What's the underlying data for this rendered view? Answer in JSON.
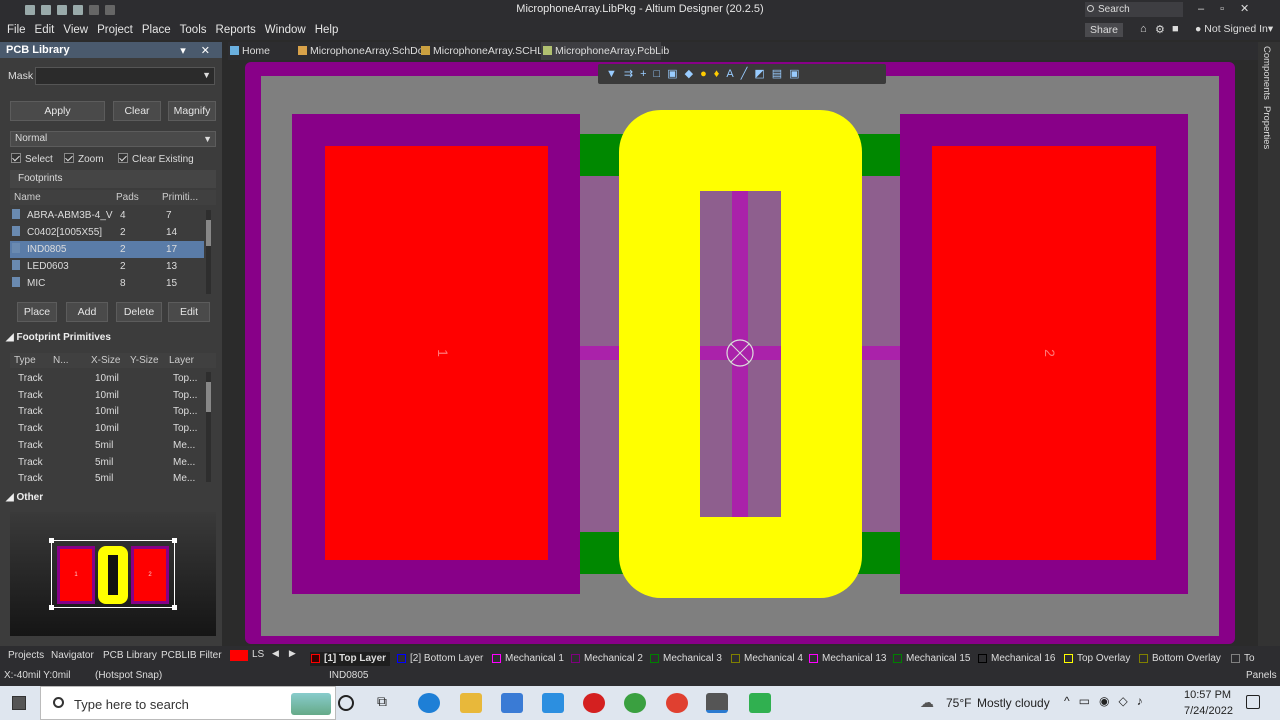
{
  "window": {
    "title": "MicrophoneArray.LibPkg - Altium Designer (20.2.5)",
    "search": "Search",
    "share": "Share",
    "account": "Not Signed In"
  },
  "menu": [
    "File",
    "Edit",
    "View",
    "Project",
    "Place",
    "Tools",
    "Reports",
    "Window",
    "Help"
  ],
  "panel": {
    "title": "PCB Library",
    "mask_label": "Mask",
    "mask_value": "",
    "apply": "Apply",
    "clear": "Clear",
    "magnify": "Magnify",
    "mode": "Normal",
    "select": "Select",
    "zoom": "Zoom",
    "clear_existing": "Clear Existing",
    "footprints_title": "Footprints",
    "fp_headers": [
      "Name",
      "Pads",
      "Primiti..."
    ],
    "footprints": [
      {
        "name": "ABRA-ABM3B-4_V",
        "pads": "4",
        "prims": "7"
      },
      {
        "name": "C0402[1005X55]",
        "pads": "2",
        "prims": "14"
      },
      {
        "name": "IND0805",
        "pads": "2",
        "prims": "17"
      },
      {
        "name": "LED0603",
        "pads": "2",
        "prims": "13"
      },
      {
        "name": "MIC",
        "pads": "8",
        "prims": "15"
      }
    ],
    "place": "Place",
    "add": "Add",
    "delete": "Delete",
    "edit": "Edit",
    "prims_title": "Footprint Primitives",
    "prim_headers": [
      "Type",
      "N...",
      "X-Size",
      "Y-Size",
      "Layer"
    ],
    "primitives": [
      {
        "type": "Track",
        "x": "10mil",
        "layer": "Top..."
      },
      {
        "type": "Track",
        "x": "10mil",
        "layer": "Top..."
      },
      {
        "type": "Track",
        "x": "10mil",
        "layer": "Top..."
      },
      {
        "type": "Track",
        "x": "10mil",
        "layer": "Top..."
      },
      {
        "type": "Track",
        "x": "5mil",
        "layer": "Me..."
      },
      {
        "type": "Track",
        "x": "5mil",
        "layer": "Me..."
      },
      {
        "type": "Track",
        "x": "5mil",
        "layer": "Me..."
      }
    ],
    "other_title": "Other",
    "preview_pad1": "1",
    "preview_pad2": "2"
  },
  "doc_tabs": [
    "Home Page",
    "MicrophoneArray.SchDoc",
    "MicrophoneArray.SCHLIB",
    "MicrophoneArray.PcbLib"
  ],
  "canvas": {
    "pad1": "1",
    "pad2": "2"
  },
  "right_tabs": [
    "Components",
    "Properties"
  ],
  "bottom_panels": [
    "Projects",
    "Navigator",
    "PCB Library",
    "PCBLIB Filter"
  ],
  "ls": "LS",
  "layers": [
    {
      "name": "[1] Top Layer",
      "color": "#ff0000"
    },
    {
      "name": "[2] Bottom Layer",
      "color": "#0000ff"
    },
    {
      "name": "Mechanical 1",
      "color": "#ff00ff"
    },
    {
      "name": "Mechanical 2",
      "color": "#800080"
    },
    {
      "name": "Mechanical 3",
      "color": "#008000"
    },
    {
      "name": "Mechanical 4",
      "color": "#808000"
    },
    {
      "name": "Mechanical 13",
      "color": "#ff00ff"
    },
    {
      "name": "Mechanical 15",
      "color": "#008000"
    },
    {
      "name": "Mechanical 16",
      "color": "#000000"
    },
    {
      "name": "Top Overlay",
      "color": "#ffff00"
    },
    {
      "name": "Bottom Overlay",
      "color": "#808000"
    },
    {
      "name": "To",
      "color": "#808080"
    }
  ],
  "statusline": {
    "coords": "X:-40mil Y:0mil",
    "snap": "(Hotspot Snap)",
    "component": "IND0805",
    "panels": "Panels"
  },
  "taskbar": {
    "search_placeholder": "Type here to search",
    "temp": "75°F",
    "weather": "Mostly cloudy",
    "time": "10:57 PM",
    "date": "7/24/2022"
  },
  "colors": {
    "pad": "#ff0000",
    "mech": "#880088",
    "overlay": "#ffff00",
    "green": "#008800",
    "board": "#7f7f7f"
  }
}
